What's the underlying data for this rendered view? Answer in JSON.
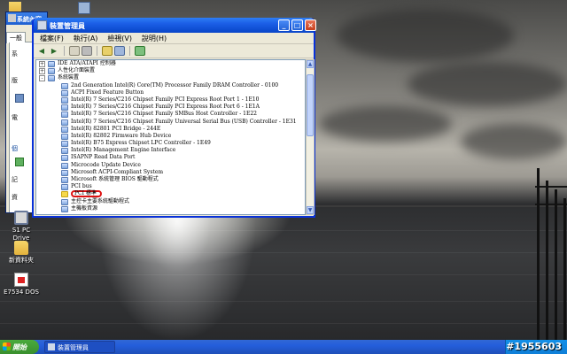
{
  "background_window": {
    "title": "系統內容",
    "tab": "一般",
    "fragments": [
      "系",
      "版",
      "電",
      "個",
      "記",
      "資"
    ]
  },
  "device_manager": {
    "title": "裝置管理員",
    "menu": [
      "檔案(F)",
      "執行(A)",
      "檢視(V)",
      "說明(H)"
    ],
    "tree": [
      {
        "label": "IDE ATA/ATAPI 控制器",
        "level": 1,
        "expander": "+"
      },
      {
        "label": "人性化介面裝置",
        "level": 1,
        "expander": "+"
      },
      {
        "label": "系統裝置",
        "level": 1,
        "expander": "-"
      },
      {
        "label": "2nd Generation Intel(R) Core(TM) Processor Family DRAM Controller - 0100",
        "level": 2
      },
      {
        "label": "ACPI Fixed Feature Button",
        "level": 2
      },
      {
        "label": "Intel(R) 7 Series/C216 Chipset Family PCI Express Root Port 1 - 1E10",
        "level": 2
      },
      {
        "label": "Intel(R) 7 Series/C216 Chipset Family PCI Express Root Port 6 - 1E1A",
        "level": 2
      },
      {
        "label": "Intel(R) 7 Series/C216 Chipset Family SMBus Host Controller - 1E22",
        "level": 2
      },
      {
        "label": "Intel(R) 7 Series/C216 Chipset Family Universal Serial Bus (USB) Controller - 1E31",
        "level": 2
      },
      {
        "label": "Intel(R) 82801 PCI Bridge - 244E",
        "level": 2
      },
      {
        "label": "Intel(R) 82802 Firmware Hub Device",
        "level": 2
      },
      {
        "label": "Intel(R) B75 Express Chipset LPC Controller - 1E49",
        "level": 2
      },
      {
        "label": "Intel(R) Management Engine Interface",
        "level": 2
      },
      {
        "label": "ISAPNP Read Data Port",
        "level": 2
      },
      {
        "label": "Microcode Update Device",
        "level": 2
      },
      {
        "label": "Microsoft ACPI-Compliant System",
        "level": 2
      },
      {
        "label": "Microsoft 系統管理 BIOS 驅動程式",
        "level": 2
      },
      {
        "label": "PCI bus",
        "level": 2
      },
      {
        "label": "PCI 標準",
        "level": 2,
        "selected": true,
        "warning": true
      },
      {
        "label": "主控卡主要系統驅動程式",
        "level": 2
      },
      {
        "label": "主機板資源",
        "level": 2
      }
    ]
  },
  "desktop_icons": [
    {
      "label": "S1 PC Drive"
    },
    {
      "label": "新資料夾"
    },
    {
      "label": "E7534 DOS"
    }
  ],
  "taskbar": {
    "start_label": "開始",
    "task_button": "裝置管理員"
  },
  "watermark": "#1955603"
}
